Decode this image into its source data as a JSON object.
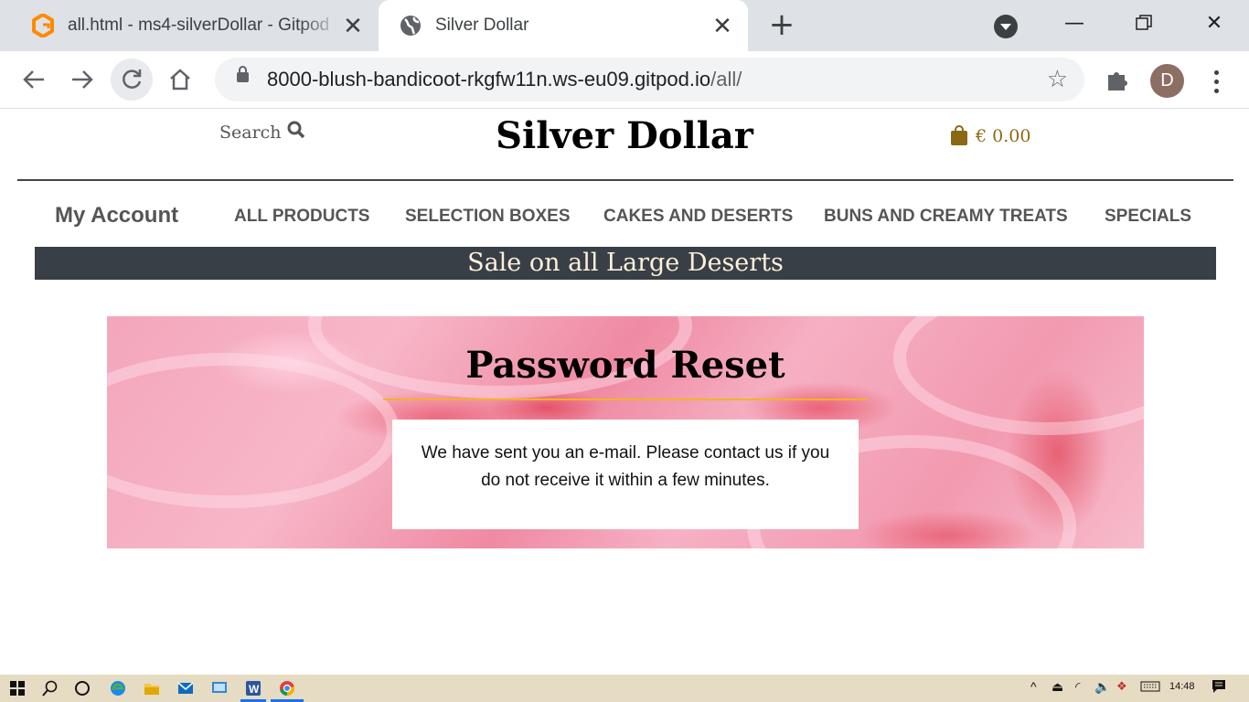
{
  "browser": {
    "tabs": [
      {
        "title": "all.html - ms4-silverDollar - Gitpod",
        "favicon": "gitpod-icon",
        "active": false
      },
      {
        "title": "Silver Dollar",
        "favicon": "globe-icon",
        "active": true
      }
    ],
    "url_host": "8000-blush-bandicoot-rkgfw11n.ws-eu09.gitpod.io",
    "url_path": "/all/",
    "profile_initial": "D"
  },
  "site": {
    "search_label": "Search",
    "brand": "Silver Dollar",
    "cart_total": "€ 0.00",
    "account_label": "My Account",
    "nav": [
      "ALL PRODUCTS",
      "SELECTION BOXES",
      "CAKES AND DESERTS",
      "BUNS AND CREAMY TREATS",
      "SPECIALS"
    ],
    "banner": "Sale on all Large Deserts",
    "colors": {
      "banner_bg": "#383f47",
      "banner_text": "#fff0d9",
      "accent_gold": "#f0b428",
      "cart": "#8b6914"
    }
  },
  "main": {
    "heading": "Password Reset",
    "message": "We have sent you an e-mail. Please contact us if you do not receive it within a few minutes."
  },
  "taskbar": {
    "time": "14:48"
  }
}
